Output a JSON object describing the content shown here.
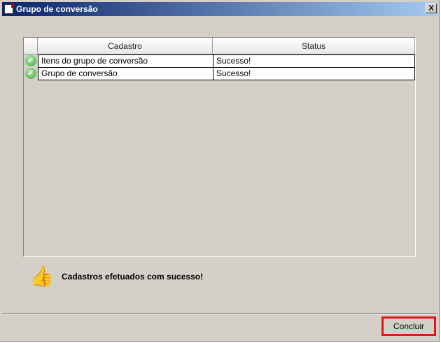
{
  "window": {
    "title": "Grupo de conversão",
    "close_label": "X"
  },
  "grid": {
    "columns": [
      "Cadastro",
      "Status"
    ],
    "rows": [
      {
        "cadastro": "Itens do grupo de conversão",
        "status": "Sucesso!"
      },
      {
        "cadastro": "Grupo de conversão",
        "status": "Sucesso!"
      }
    ]
  },
  "message": "Cadastros efetuados com sucesso!",
  "buttons": {
    "concluir": "Concluir"
  },
  "colors": {
    "highlight": "#e8141c",
    "success": "#3aa33a"
  }
}
